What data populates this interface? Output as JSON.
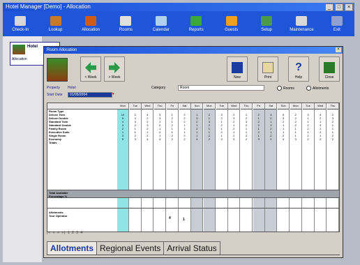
{
  "window": {
    "title": "Hotel Manager [Demo] - Allocation"
  },
  "toolbar": {
    "buttons": [
      {
        "label": "Check-In",
        "icon": "checkin-icon",
        "color": "#d8d8d8"
      },
      {
        "label": "Lookup",
        "icon": "lookup-icon",
        "color": "#c87a28"
      },
      {
        "label": "Allocation",
        "icon": "allocation-icon",
        "color": "#d05a18"
      },
      {
        "label": "Rooms",
        "icon": "rooms-icon",
        "color": "#e0e0e0"
      },
      {
        "label": "Calendar",
        "icon": "calendar-icon",
        "color": "#b0d0f0"
      },
      {
        "label": "Reports",
        "icon": "reports-icon",
        "color": "#3aa83a"
      },
      {
        "label": "Guests",
        "icon": "guests-icon",
        "color": "#f0a020"
      },
      {
        "label": "Setup",
        "icon": "setup-icon",
        "color": "#4a9a4a"
      },
      {
        "label": "Maintenance",
        "icon": "maintenance-icon",
        "color": "#d8d8d8"
      },
      {
        "label": "Exit",
        "icon": "exit-icon",
        "color": "#90a0d0"
      }
    ]
  },
  "sidebar": {
    "item_title": "Hotel",
    "item_sub": "Allocation"
  },
  "dialog": {
    "title": "Room Allocation",
    "buttons": {
      "prev": "< Week",
      "next": "> Week",
      "new": "New",
      "print": "Print",
      "help": "Help",
      "close": "Close"
    },
    "filters": {
      "property_label": "Property",
      "property_value": "Hotel",
      "start_label": "Start Date",
      "start_value": "01/05/2004",
      "category_label": "Category",
      "category_value": "Room",
      "radio1": "Rooms",
      "radio2": "Allotments"
    }
  },
  "grid": {
    "row_labels": [
      "Room Type",
      "Deluxe Twin",
      "Deluxe Double",
      "Standard Twin",
      "Standard Double",
      "Family Room",
      "Executive Suite",
      "Single Room",
      "Economy",
      "Totals"
    ],
    "col_headers": [
      "Mon",
      "Tue",
      "Wed",
      "Thu",
      "Fri",
      "Sat",
      "Sun",
      "Mon",
      "Tue",
      "Wed",
      "Thu",
      "Fri",
      "Sat",
      "Sun",
      "Mon",
      "Tue",
      "Wed",
      "Thu"
    ],
    "values": [
      [
        "10",
        "2",
        "4",
        "3",
        "1",
        "2",
        "1",
        "2",
        "3",
        "2",
        "1",
        "2",
        "3",
        "5",
        "2",
        "3",
        "4",
        "2"
      ],
      [
        "5",
        "4",
        "2",
        "3",
        "2",
        "2",
        "3",
        "1",
        "2",
        "3",
        "2",
        "1",
        "2",
        "3",
        "2",
        "1",
        "2",
        "3"
      ],
      [
        "4",
        "3",
        "2",
        "1",
        "1",
        "2",
        "2",
        "3",
        "1",
        "2",
        "3",
        "2",
        "1",
        "2",
        "2",
        "1",
        "1",
        "2"
      ],
      [
        "3",
        "2",
        "3",
        "2",
        "2",
        "1",
        "1",
        "2",
        "2",
        "1",
        "2",
        "2",
        "3",
        "1",
        "2",
        "2",
        "3",
        "1"
      ],
      [
        "2",
        "1",
        "2",
        "1",
        "1",
        "1",
        "2",
        "1",
        "1",
        "2",
        "1",
        "1",
        "2",
        "1",
        "1",
        "2",
        "1",
        "1"
      ],
      [
        "1",
        "1",
        "1",
        "2",
        "1",
        "1",
        "1",
        "1",
        "2",
        "1",
        "1",
        "2",
        "1",
        "1",
        "1",
        "1",
        "2",
        "1"
      ],
      [
        "3",
        "2",
        "2",
        "1",
        "2",
        "2",
        "1",
        "2",
        "1",
        "2",
        "2",
        "1",
        "2",
        "2",
        "1",
        "2",
        "1",
        "2"
      ],
      [
        "5",
        "3",
        "4",
        "3",
        "2",
        "2",
        "4",
        "2",
        "3",
        "3",
        "2",
        "3",
        "2",
        "4",
        "3",
        "2",
        "3",
        "2"
      ]
    ],
    "band_label": "Total Available",
    "band_sub": "Percentage %",
    "lower_label": "Allotments",
    "lower_sub": "Tour Operator",
    "lower_values": [
      "4",
      "1"
    ]
  },
  "navbar": "|< < > >| 1 2 3 4",
  "tabs": [
    {
      "label": "Allotments",
      "active": true
    },
    {
      "label": "Regional Events",
      "active": false
    },
    {
      "label": "Arrival Status",
      "active": false
    }
  ]
}
